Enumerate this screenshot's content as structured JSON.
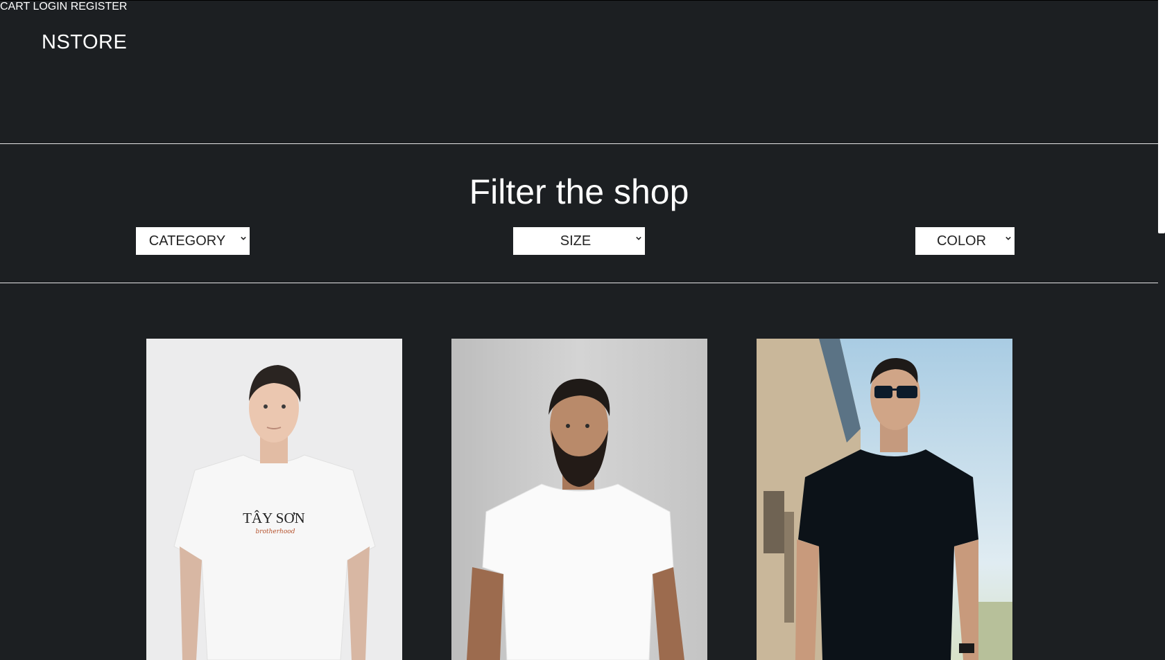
{
  "header": {
    "logo": "NSTORE",
    "nav": [
      {
        "label": "CART"
      },
      {
        "label": "LOGIN"
      },
      {
        "label": "REGISTER"
      }
    ]
  },
  "filter": {
    "title": "Filter the shop",
    "selects": [
      {
        "label": "CATEGORY"
      },
      {
        "label": "SIZE"
      },
      {
        "label": "COLOR"
      }
    ]
  },
  "products": [
    {
      "image": "man in white printed t-shirt",
      "shirt_print": "TÂY SƠN",
      "shirt_print_sub": "brotherhood"
    },
    {
      "image": "bearded man in white t-shirt"
    },
    {
      "image": "man in black t-shirt with sunglasses"
    }
  ],
  "colors": {
    "background": "#1c1f22",
    "text": "#ffffff",
    "select_bg": "#ffffff"
  }
}
